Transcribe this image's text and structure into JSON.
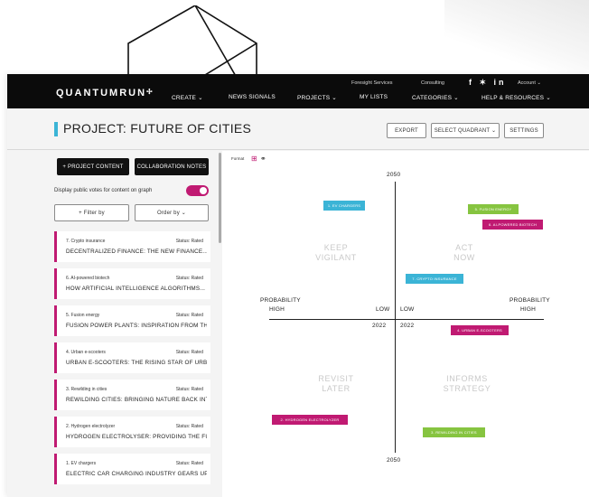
{
  "brand": "QUANTUMRUN",
  "nav": {
    "create": "CREATE ⌄",
    "signals": "NEWS SIGNALS",
    "projects": "PROJECTS ⌄",
    "foresight": "Foresight Services",
    "mylists": "MY LISTS",
    "consulting": "Consulting",
    "categories": "CATEGORIES ⌄",
    "social": "f ✶ in",
    "account": "Account ⌄",
    "help": "HELP & RESOURCES ⌄"
  },
  "header": {
    "title": "PROJECT: FUTURE OF CITIES",
    "export": "EXPORT",
    "quadrant": "SELECT QUADRANT ⌄",
    "settings": "SETTINGS"
  },
  "sidebar": {
    "add_content": "+  PROJECT CONTENT",
    "collab_notes": "COLLABORATION NOTES",
    "votes_label": "Display public votes for content on graph",
    "filter": "+   Filter by",
    "order": "Order by  ⌄",
    "cards": [
      {
        "idx": "7. Crypto insurance",
        "status": "Status: Rated",
        "title": "DECENTRALIZED FINANCE: THE NEW FINANCE..."
      },
      {
        "idx": "6. AI-powered biotech",
        "status": "Status: Rated",
        "title": "HOW ARTIFICIAL INTELLIGENCE ALGORITHMS..."
      },
      {
        "idx": "5. Fusion energy",
        "status": "Status: Rated",
        "title": "FUSION POWER PLANTS: INSPIRATION FROM THE..."
      },
      {
        "idx": "4. Urban e-scooters",
        "status": "Status: Rated",
        "title": "URBAN E-SCOOTERS: THE RISING STAR OF URBAN..."
      },
      {
        "idx": "3. Rewilding in cities",
        "status": "Status: Rated",
        "title": "REWILDING CITIES: BRINGING NATURE BACK INTO..."
      },
      {
        "idx": "2. Hydrogen electrolyzer",
        "status": "Status: Rated",
        "title": "HYDROGEN ELECTROLYSER: PROVIDING THE FUEL..."
      },
      {
        "idx": "1. EV chargers",
        "status": "Status: Rated",
        "title": "ELECTRIC CAR CHARGING INDUSTRY GEARS UP..."
      }
    ]
  },
  "graph": {
    "format_label": "Format",
    "top_year": "2050",
    "bottom_year": "2050",
    "left_axis_label_1": "PROBABILITY",
    "left_axis_label_2": "HIGH",
    "right_axis_label_1": "PROBABILITY",
    "right_axis_label_2": "HIGH",
    "low_left": "LOW",
    "low_right": "LOW",
    "year_left": "2022",
    "year_right": "2022",
    "q_keep_1": "KEEP",
    "q_keep_2": "VIGILANT",
    "q_act_1": "ACT",
    "q_act_2": "NOW",
    "q_revisit_1": "REVISIT",
    "q_revisit_2": "LATER",
    "q_informs_1": "INFORMS",
    "q_informs_2": "STRATEGY",
    "tags": {
      "ev": "1. EV CHARGERS",
      "fusion": "5. FUSION ENERGY",
      "biotech": "6. AI-POWERED BIOTECH",
      "crypto": "7. CRYPTO INSURANCE",
      "scooters": "4. URBAN E-SCOOTERS",
      "hydrogen": "2. HYDROGEN ELECTROLYZER",
      "rewilding": "3. REWILDING IN CITIES"
    }
  },
  "colors": {
    "accent_blue": "#3bb4d6",
    "accent_magenta": "#c01a72",
    "accent_green": "#86c440"
  }
}
